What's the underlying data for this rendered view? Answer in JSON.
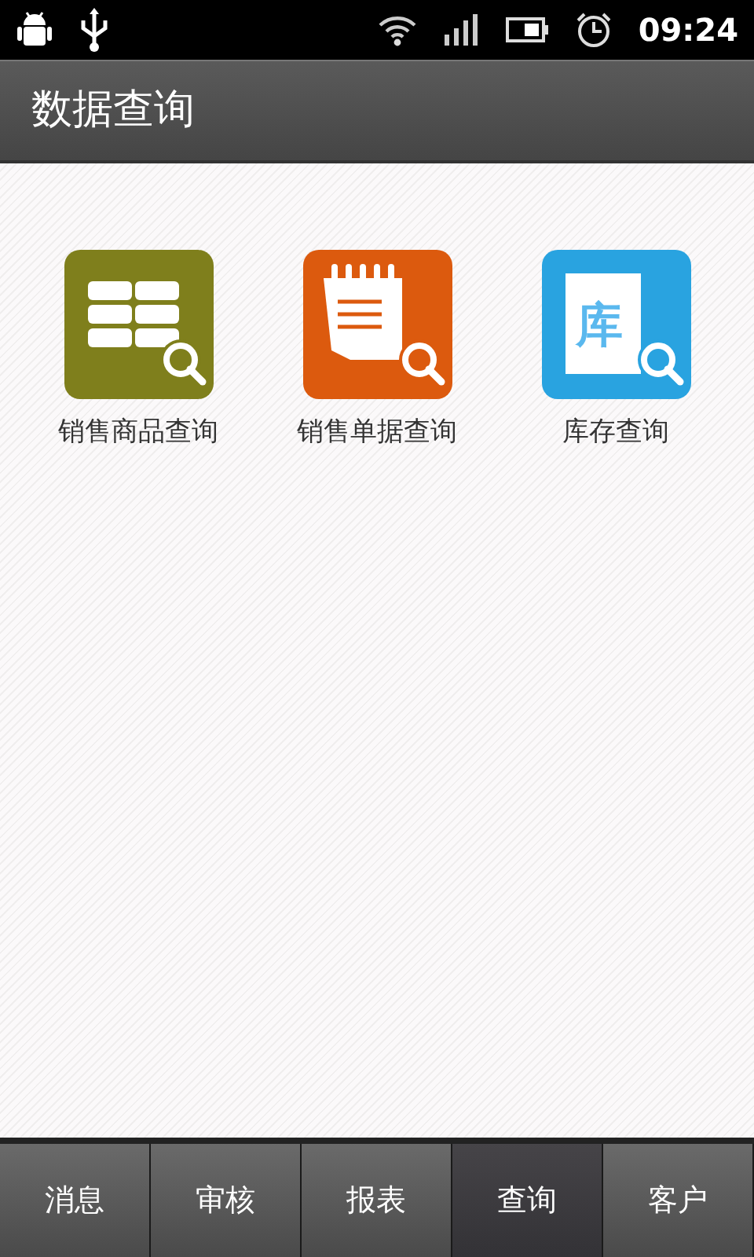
{
  "status_bar": {
    "time": "09:24"
  },
  "title": "数据查询",
  "tiles": [
    {
      "kind": "grid",
      "label": "销售商品查询",
      "color": "#7f7f1c"
    },
    {
      "kind": "notepad",
      "label": "销售单据查询",
      "color": "#dc5a0e"
    },
    {
      "kind": "document",
      "label": "库存查询",
      "color": "#29a3e0",
      "glyph": "库"
    }
  ],
  "tabs": [
    {
      "label": "消息",
      "selected": false
    },
    {
      "label": "审核",
      "selected": false
    },
    {
      "label": "报表",
      "selected": false
    },
    {
      "label": "查询",
      "selected": true
    },
    {
      "label": "客户",
      "selected": false
    }
  ]
}
